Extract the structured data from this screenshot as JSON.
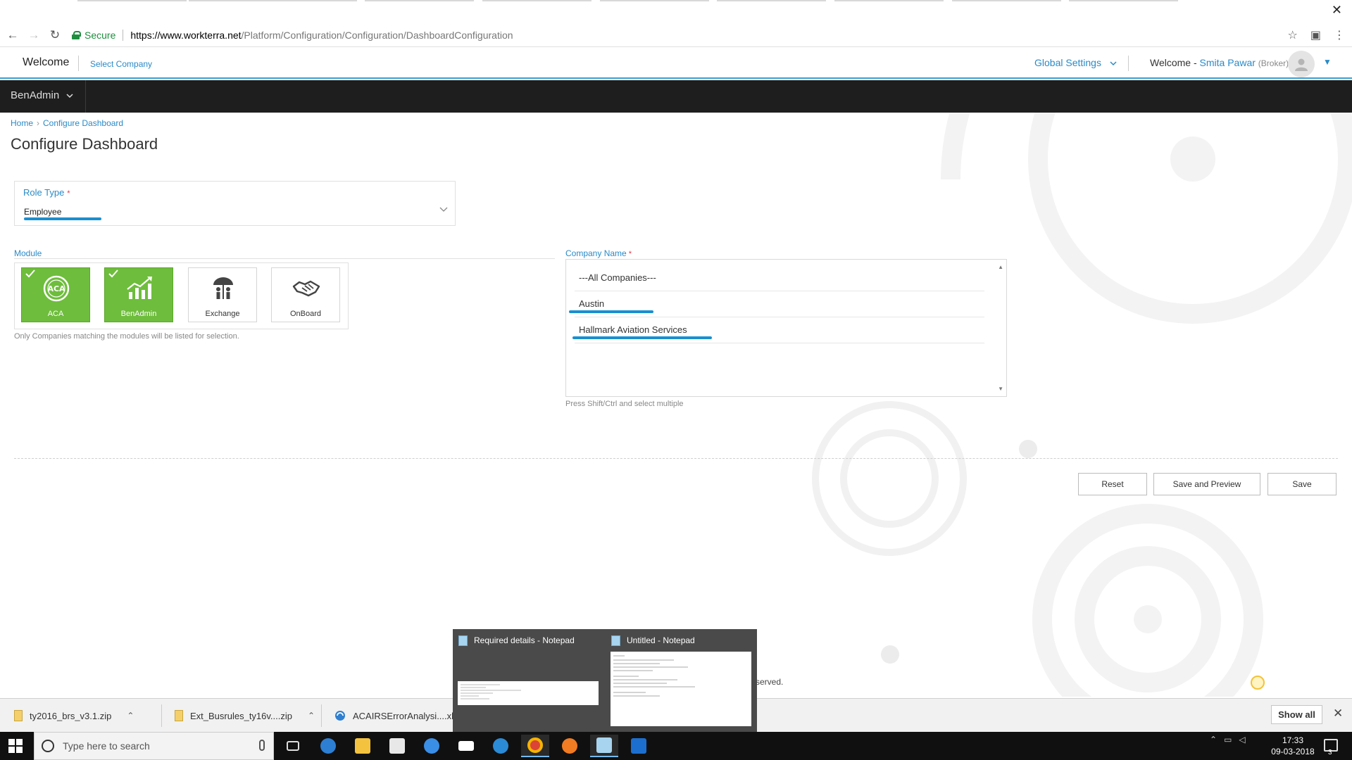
{
  "browser": {
    "secure_label": "Secure",
    "url_host": "https://www.workterra.net",
    "url_path": "/Platform/Configuration/Configuration/DashboardConfiguration"
  },
  "header": {
    "welcome": "Welcome",
    "select_company": "Select Company",
    "global_settings": "Global Settings",
    "welcome_user_prefix": "Welcome - ",
    "user_name": "Smita Pawar",
    "user_role": "(Broker)"
  },
  "nav": {
    "module_menu": "BenAdmin"
  },
  "breadcrumb": {
    "home": "Home",
    "current": "Configure Dashboard"
  },
  "page": {
    "title": "Configure Dashboard"
  },
  "role_type": {
    "label": "Role Type",
    "required": "*",
    "value": "Employee"
  },
  "module": {
    "label": "Module",
    "items": [
      {
        "label": "ACA",
        "selected": true,
        "icon": "aca-icon"
      },
      {
        "label": "BenAdmin",
        "selected": true,
        "icon": "chart-growth-icon"
      },
      {
        "label": "Exchange",
        "selected": false,
        "icon": "umbrella-family-icon"
      },
      {
        "label": "OnBoard",
        "selected": false,
        "icon": "handshake-icon"
      }
    ],
    "hint": "Only Companies matching the modules will be listed for selection."
  },
  "company": {
    "label": "Company Name",
    "required": "*",
    "options": [
      "---All Companies---",
      "Austin",
      "Hallmark Aviation Services"
    ],
    "hint": "Press Shift/Ctrl and select multiple"
  },
  "buttons": {
    "reset": "Reset",
    "save_preview": "Save and Preview",
    "save": "Save"
  },
  "footer": {
    "text": "served."
  },
  "previews": [
    {
      "title": "Required details  - Notepad"
    },
    {
      "title": "Untitled - Notepad"
    }
  ],
  "downloads": {
    "items": [
      "ty2016_brs_v3.1.zip",
      "Ext_Busrules_ty16v....zip",
      "ACAIRSErrorAnalysi....xls"
    ],
    "show_all": "Show all"
  },
  "taskbar": {
    "search_placeholder": "Type here to search",
    "time": "17:33",
    "date": "09-03-2018",
    "notification_count": "3"
  },
  "colors": {
    "accent": "#2a8ac7",
    "selected_module": "#6ebd3c",
    "underline": "#1a8fcf",
    "dark_nav": "#1e1e1e"
  }
}
